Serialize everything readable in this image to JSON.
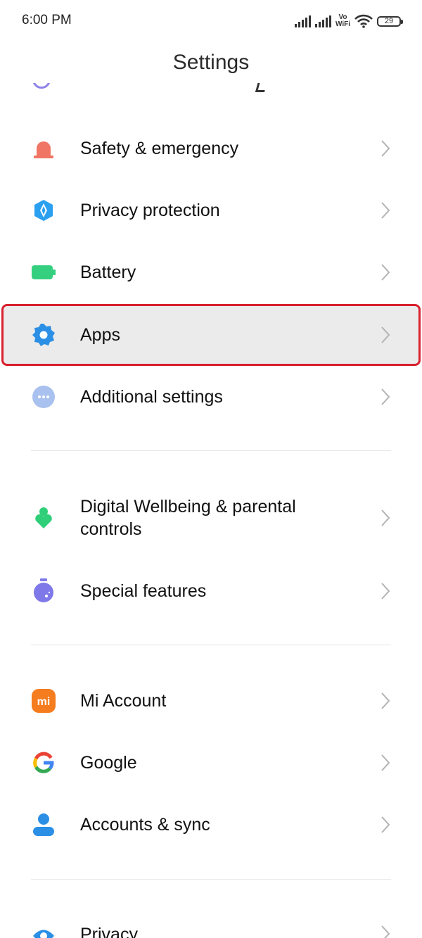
{
  "status_bar": {
    "time": "6:00 PM",
    "vowifi_top": "Vo",
    "vowifi_bottom": "WiFi",
    "battery_level": "29"
  },
  "header": {
    "title": "Settings"
  },
  "settings": {
    "safety": {
      "label": "Safety & emergency",
      "icon": "alarm-icon",
      "color": "#f07564"
    },
    "privacy_protection": {
      "label": "Privacy protection",
      "icon": "shield-icon",
      "color": "#2b9ff0"
    },
    "battery": {
      "label": "Battery",
      "icon": "battery-icon",
      "color": "#35d07f"
    },
    "apps": {
      "label": "Apps",
      "icon": "gear-icon",
      "color": "#2b8fe6",
      "highlight_border": "#d8202e"
    },
    "additional": {
      "label": "Additional settings",
      "icon": "more-dots-icon",
      "color": "#a9c1ee"
    },
    "wellbeing": {
      "label_line1": "Digital Wellbeing & parental",
      "label_line2": "controls",
      "icon": "wellbeing-icon",
      "color": "#2fcf79"
    },
    "special": {
      "label": "Special features",
      "icon": "flask-icon",
      "color": "#7e78e8"
    },
    "mi_account": {
      "label": "Mi Account",
      "icon": "mi-logo-icon",
      "icon_text": "mi",
      "color": "#f57c1f"
    },
    "google": {
      "label": "Google",
      "icon": "google-icon"
    },
    "accounts_sync": {
      "label": "Accounts & sync",
      "icon": "person-icon",
      "color": "#2b8fe6"
    },
    "privacy": {
      "label": "Privacy",
      "icon": "eye-icon",
      "color": "#2b8fe6"
    }
  }
}
